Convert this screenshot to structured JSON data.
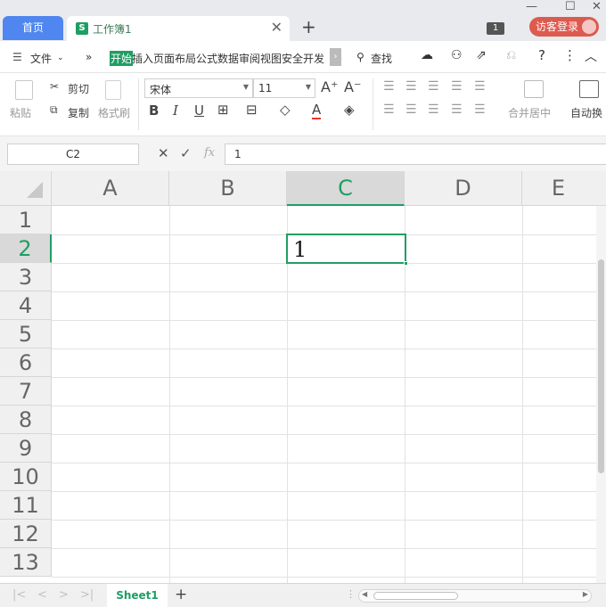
{
  "titlebar": {
    "home_tab": "首页",
    "doc_icon": "S",
    "doc_title": "工作簿1",
    "close_glyph": "✕",
    "new_tab_glyph": "+",
    "badge": "1",
    "login_label": "访客登录"
  },
  "menubar": {
    "file": "文件",
    "tabs": [
      "开始",
      "插入",
      "页面布局",
      "公式",
      "数据",
      "审阅",
      "视图",
      "安全",
      "开发"
    ],
    "search": "查找"
  },
  "ribbon": {
    "paste": "粘贴",
    "cut": "剪切",
    "copy": "复制",
    "format_painter": "格式刷",
    "font_name": "宋体",
    "font_size": "11",
    "bold": "B",
    "italic": "I",
    "underline": "U",
    "font_color_glyph": "A",
    "merge_center": "合并居中",
    "auto_wrap": "自动换"
  },
  "formula": {
    "name_box": "C2",
    "fx_label": "fx",
    "content": "1"
  },
  "grid": {
    "columns": [
      "A",
      "B",
      "C",
      "D",
      "E"
    ],
    "rows": [
      "1",
      "2",
      "3",
      "4",
      "5",
      "6",
      "7",
      "8",
      "9",
      "10",
      "11",
      "12",
      "13"
    ],
    "selected_cell_value": "1"
  },
  "sheets": {
    "active": "Sheet1",
    "add_glyph": "+"
  },
  "colors": {
    "accent": "#1f9e63",
    "home_tab": "#4f86ef",
    "login": "#dd5a4f"
  }
}
